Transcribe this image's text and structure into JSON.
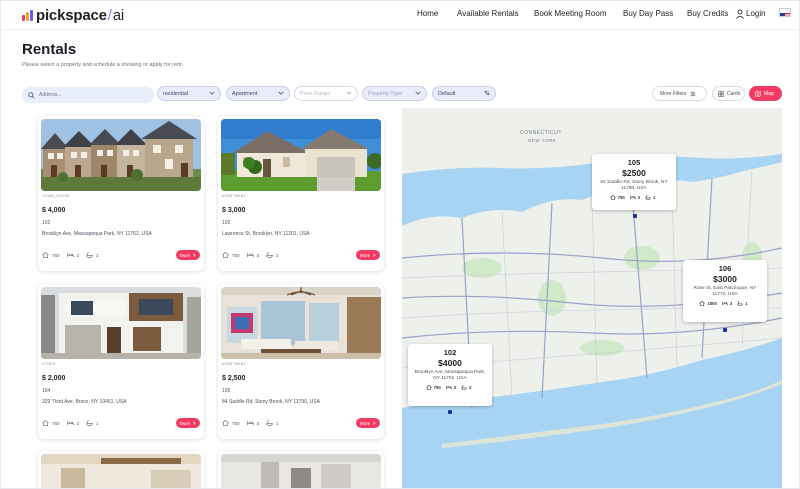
{
  "brand": {
    "name": "pickspace",
    "slash": "/",
    "suffix": "ai",
    "bar_colors": [
      "#f23a63",
      "#f5a524",
      "#6b5cf0"
    ]
  },
  "nav": {
    "items": [
      "Home",
      "Available Rentals",
      "Book Meeting Room",
      "Buy Day Pass",
      "Buy Credits"
    ],
    "login": "Login",
    "login_icon": "user-icon",
    "flag_icon": "us-flag-icon"
  },
  "page": {
    "title": "Rentals",
    "subtitle": "Please select a property and schedule a showing or apply for rent."
  },
  "filters": {
    "search_placeholder": "Address...",
    "search_icon": "search-icon",
    "category": "residential",
    "property_kind": "Apartment",
    "price_range": "Price Range",
    "property_type": "Property Type",
    "sort": "Default",
    "more_filters": "More Filters",
    "cards": "Cards",
    "map": "Map",
    "active_view": "Map"
  },
  "listings": [
    {
      "type": "TOWN_HOUSE",
      "price": "$ 4,000",
      "unit": "102",
      "address": "Brooklyn Ave, Massapequa Park, NY 11762, USA",
      "sqft": "750",
      "beds": "3",
      "baths": "2",
      "more": "More"
    },
    {
      "type": "APARTMENT",
      "price": "$ 3,000",
      "unit": "102",
      "address": "Lawrence St, Brooklyn, NY 11201, USA",
      "sqft": "750",
      "beds": "3",
      "baths": "2",
      "more": "More"
    },
    {
      "type": "OTHER",
      "price": "$ 2,000",
      "unit": "104",
      "address": "329 Third Ave, Bronx, NY 10451, USA",
      "sqft": "750",
      "beds": "3",
      "baths": "1",
      "more": "More"
    },
    {
      "type": "APARTMENT",
      "price": "$ 2,500",
      "unit": "105",
      "address": "84 Saddle Rd, Stony Brook, NY 11790, USA",
      "sqft": "750",
      "beds": "3",
      "baths": "1",
      "more": "More"
    }
  ],
  "map": {
    "labels": [
      "CONNECTICUT",
      "NEW YORK"
    ],
    "colors": {
      "water": "#a6d4f2",
      "land": "#eef0ec",
      "park": "#cfe9c9",
      "road": "#9aa0c8"
    },
    "popups": [
      {
        "id": "105",
        "price": "$2500",
        "address": "84 Saddle Rd, Stony Brook, NY 11790, USA",
        "sqft": "750",
        "beds": "3",
        "baths": "1"
      },
      {
        "id": "106",
        "price": "$3000",
        "address": "Rose St, East Patchogue, NY 11772, USA",
        "sqft": "1000",
        "beds": "3",
        "baths": "1"
      },
      {
        "id": "102",
        "price": "$4000",
        "address": "Brooklyn Ave, Massapequa Park, NY 11762, USA",
        "sqft": "750",
        "beds": "3",
        "baths": "2"
      }
    ]
  }
}
